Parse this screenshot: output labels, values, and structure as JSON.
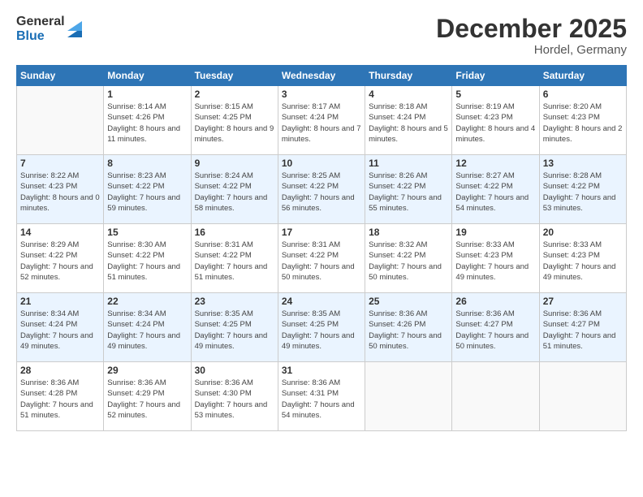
{
  "logo": {
    "general": "General",
    "blue": "Blue"
  },
  "header": {
    "month": "December 2025",
    "location": "Hordel, Germany"
  },
  "weekdays": [
    "Sunday",
    "Monday",
    "Tuesday",
    "Wednesday",
    "Thursday",
    "Friday",
    "Saturday"
  ],
  "weeks": [
    [
      {
        "day": "",
        "sunrise": "",
        "sunset": "",
        "daylight": ""
      },
      {
        "day": "1",
        "sunrise": "Sunrise: 8:14 AM",
        "sunset": "Sunset: 4:26 PM",
        "daylight": "Daylight: 8 hours and 11 minutes."
      },
      {
        "day": "2",
        "sunrise": "Sunrise: 8:15 AM",
        "sunset": "Sunset: 4:25 PM",
        "daylight": "Daylight: 8 hours and 9 minutes."
      },
      {
        "day": "3",
        "sunrise": "Sunrise: 8:17 AM",
        "sunset": "Sunset: 4:24 PM",
        "daylight": "Daylight: 8 hours and 7 minutes."
      },
      {
        "day": "4",
        "sunrise": "Sunrise: 8:18 AM",
        "sunset": "Sunset: 4:24 PM",
        "daylight": "Daylight: 8 hours and 5 minutes."
      },
      {
        "day": "5",
        "sunrise": "Sunrise: 8:19 AM",
        "sunset": "Sunset: 4:23 PM",
        "daylight": "Daylight: 8 hours and 4 minutes."
      },
      {
        "day": "6",
        "sunrise": "Sunrise: 8:20 AM",
        "sunset": "Sunset: 4:23 PM",
        "daylight": "Daylight: 8 hours and 2 minutes."
      }
    ],
    [
      {
        "day": "7",
        "sunrise": "Sunrise: 8:22 AM",
        "sunset": "Sunset: 4:23 PM",
        "daylight": "Daylight: 8 hours and 0 minutes."
      },
      {
        "day": "8",
        "sunrise": "Sunrise: 8:23 AM",
        "sunset": "Sunset: 4:22 PM",
        "daylight": "Daylight: 7 hours and 59 minutes."
      },
      {
        "day": "9",
        "sunrise": "Sunrise: 8:24 AM",
        "sunset": "Sunset: 4:22 PM",
        "daylight": "Daylight: 7 hours and 58 minutes."
      },
      {
        "day": "10",
        "sunrise": "Sunrise: 8:25 AM",
        "sunset": "Sunset: 4:22 PM",
        "daylight": "Daylight: 7 hours and 56 minutes."
      },
      {
        "day": "11",
        "sunrise": "Sunrise: 8:26 AM",
        "sunset": "Sunset: 4:22 PM",
        "daylight": "Daylight: 7 hours and 55 minutes."
      },
      {
        "day": "12",
        "sunrise": "Sunrise: 8:27 AM",
        "sunset": "Sunset: 4:22 PM",
        "daylight": "Daylight: 7 hours and 54 minutes."
      },
      {
        "day": "13",
        "sunrise": "Sunrise: 8:28 AM",
        "sunset": "Sunset: 4:22 PM",
        "daylight": "Daylight: 7 hours and 53 minutes."
      }
    ],
    [
      {
        "day": "14",
        "sunrise": "Sunrise: 8:29 AM",
        "sunset": "Sunset: 4:22 PM",
        "daylight": "Daylight: 7 hours and 52 minutes."
      },
      {
        "day": "15",
        "sunrise": "Sunrise: 8:30 AM",
        "sunset": "Sunset: 4:22 PM",
        "daylight": "Daylight: 7 hours and 51 minutes."
      },
      {
        "day": "16",
        "sunrise": "Sunrise: 8:31 AM",
        "sunset": "Sunset: 4:22 PM",
        "daylight": "Daylight: 7 hours and 51 minutes."
      },
      {
        "day": "17",
        "sunrise": "Sunrise: 8:31 AM",
        "sunset": "Sunset: 4:22 PM",
        "daylight": "Daylight: 7 hours and 50 minutes."
      },
      {
        "day": "18",
        "sunrise": "Sunrise: 8:32 AM",
        "sunset": "Sunset: 4:22 PM",
        "daylight": "Daylight: 7 hours and 50 minutes."
      },
      {
        "day": "19",
        "sunrise": "Sunrise: 8:33 AM",
        "sunset": "Sunset: 4:23 PM",
        "daylight": "Daylight: 7 hours and 49 minutes."
      },
      {
        "day": "20",
        "sunrise": "Sunrise: 8:33 AM",
        "sunset": "Sunset: 4:23 PM",
        "daylight": "Daylight: 7 hours and 49 minutes."
      }
    ],
    [
      {
        "day": "21",
        "sunrise": "Sunrise: 8:34 AM",
        "sunset": "Sunset: 4:24 PM",
        "daylight": "Daylight: 7 hours and 49 minutes."
      },
      {
        "day": "22",
        "sunrise": "Sunrise: 8:34 AM",
        "sunset": "Sunset: 4:24 PM",
        "daylight": "Daylight: 7 hours and 49 minutes."
      },
      {
        "day": "23",
        "sunrise": "Sunrise: 8:35 AM",
        "sunset": "Sunset: 4:25 PM",
        "daylight": "Daylight: 7 hours and 49 minutes."
      },
      {
        "day": "24",
        "sunrise": "Sunrise: 8:35 AM",
        "sunset": "Sunset: 4:25 PM",
        "daylight": "Daylight: 7 hours and 49 minutes."
      },
      {
        "day": "25",
        "sunrise": "Sunrise: 8:36 AM",
        "sunset": "Sunset: 4:26 PM",
        "daylight": "Daylight: 7 hours and 50 minutes."
      },
      {
        "day": "26",
        "sunrise": "Sunrise: 8:36 AM",
        "sunset": "Sunset: 4:27 PM",
        "daylight": "Daylight: 7 hours and 50 minutes."
      },
      {
        "day": "27",
        "sunrise": "Sunrise: 8:36 AM",
        "sunset": "Sunset: 4:27 PM",
        "daylight": "Daylight: 7 hours and 51 minutes."
      }
    ],
    [
      {
        "day": "28",
        "sunrise": "Sunrise: 8:36 AM",
        "sunset": "Sunset: 4:28 PM",
        "daylight": "Daylight: 7 hours and 51 minutes."
      },
      {
        "day": "29",
        "sunrise": "Sunrise: 8:36 AM",
        "sunset": "Sunset: 4:29 PM",
        "daylight": "Daylight: 7 hours and 52 minutes."
      },
      {
        "day": "30",
        "sunrise": "Sunrise: 8:36 AM",
        "sunset": "Sunset: 4:30 PM",
        "daylight": "Daylight: 7 hours and 53 minutes."
      },
      {
        "day": "31",
        "sunrise": "Sunrise: 8:36 AM",
        "sunset": "Sunset: 4:31 PM",
        "daylight": "Daylight: 7 hours and 54 minutes."
      },
      {
        "day": "",
        "sunrise": "",
        "sunset": "",
        "daylight": ""
      },
      {
        "day": "",
        "sunrise": "",
        "sunset": "",
        "daylight": ""
      },
      {
        "day": "",
        "sunrise": "",
        "sunset": "",
        "daylight": ""
      }
    ]
  ]
}
